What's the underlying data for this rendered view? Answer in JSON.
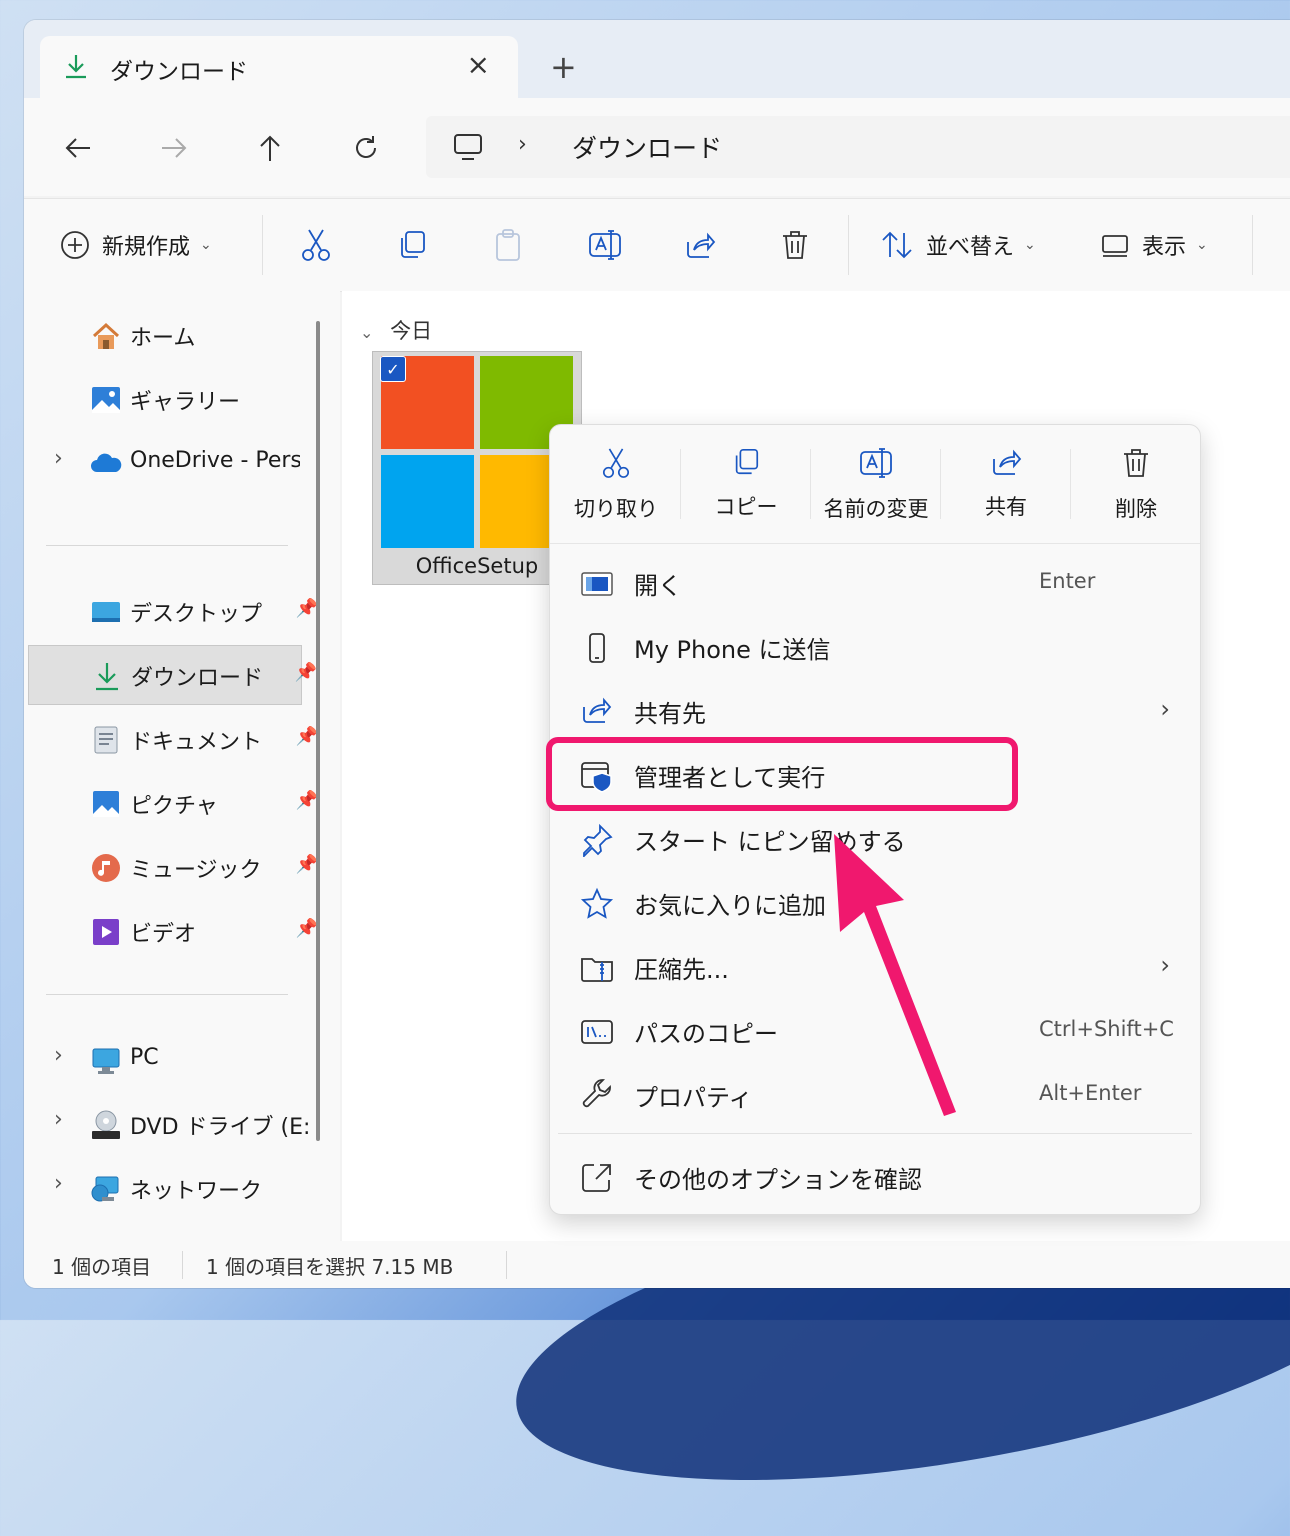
{
  "tab": {
    "title": "ダウンロード",
    "close_icon": "×",
    "new_tab_icon": "+"
  },
  "address": {
    "separator": "›",
    "crumb": "ダウンロード"
  },
  "toolbar": {
    "new_label": "新規作成",
    "sort_label": "並べ替え",
    "view_label": "表示",
    "caret": "⌄"
  },
  "sidebar": {
    "home": "ホーム",
    "gallery": "ギャラリー",
    "onedrive": "OneDrive - Perso",
    "desktop": "デスクトップ",
    "downloads": "ダウンロード",
    "documents": "ドキュメント",
    "pictures": "ピクチャ",
    "music": "ミュージック",
    "videos": "ビデオ",
    "pc": "PC",
    "dvd": "DVD ドライブ (E:) C",
    "network": "ネットワーク",
    "expand": "›",
    "pin": "📌"
  },
  "content": {
    "group": "今日",
    "group_caret": "⌄",
    "file": {
      "name": "OfficeSetup",
      "checked": "✓"
    }
  },
  "context_menu": {
    "actions": {
      "cut": "切り取り",
      "copy": "コピー",
      "rename": "名前の変更",
      "share": "共有",
      "delete": "削除"
    },
    "items": {
      "open": {
        "label": "開く",
        "shortcut": "Enter"
      },
      "phone": {
        "label": "My Phone に送信"
      },
      "share_to": {
        "label": "共有先",
        "chevron": "›"
      },
      "run_admin": {
        "label": "管理者として実行"
      },
      "pin_start": {
        "label": "スタート にピン留めする"
      },
      "favorite": {
        "label": "お気に入りに追加"
      },
      "compress": {
        "label": "圧縮先...",
        "chevron": "›"
      },
      "copy_path": {
        "label": "パスのコピー",
        "shortcut": "Ctrl+Shift+C"
      },
      "properties": {
        "label": "プロパティ",
        "shortcut": "Alt+Enter"
      },
      "more": {
        "label": "その他のオプションを確認"
      }
    }
  },
  "status": {
    "count": "1 個の項目",
    "selection": "1 個の項目を選択  7.15 MB"
  },
  "colors": {
    "accent": "#1a57c2",
    "highlight": "#f0186e",
    "ms_red": "#f25022",
    "ms_green": "#7fba00",
    "ms_blue": "#00a4ef",
    "ms_yellow": "#ffb900"
  }
}
